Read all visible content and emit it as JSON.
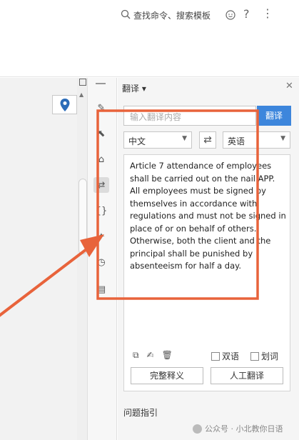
{
  "toolbar": {
    "search_label": "查找命令、搜索模板",
    "icons": [
      "search-icon",
      "emoji-icon",
      "help-icon",
      "more-icon"
    ]
  },
  "sidebar_strip": {
    "icons": [
      "pen-icon",
      "cursor-icon",
      "lock-icon",
      "translate-icon",
      "code-icon",
      "magic-icon",
      "clock-icon",
      "table-icon"
    ],
    "active": "translate-icon"
  },
  "translate_panel": {
    "title": "翻译",
    "input_placeholder": "输入翻译内容",
    "translate_button": "翻译",
    "source_lang": "中文",
    "target_lang": "英语",
    "result_text": "Article 7 attendance of employees shall be carried out on the nail APP. All employees must be signed by themselves in accordance with regulations and must not be signed in place of or on behalf of others. Otherwise, both the client and the principal shall be punished by absenteeism for half a day.",
    "checkbox_bilingual": "双语",
    "checkbox_select": "划词",
    "full_definition_button": "完整释义",
    "human_translate_button": "人工翻译"
  },
  "help_section": {
    "title": "问题指引"
  },
  "watermark": {
    "text": "公众号 · 小北教你日语"
  },
  "colors": {
    "accent": "#3d86dc",
    "annotation": "#e8633b"
  }
}
